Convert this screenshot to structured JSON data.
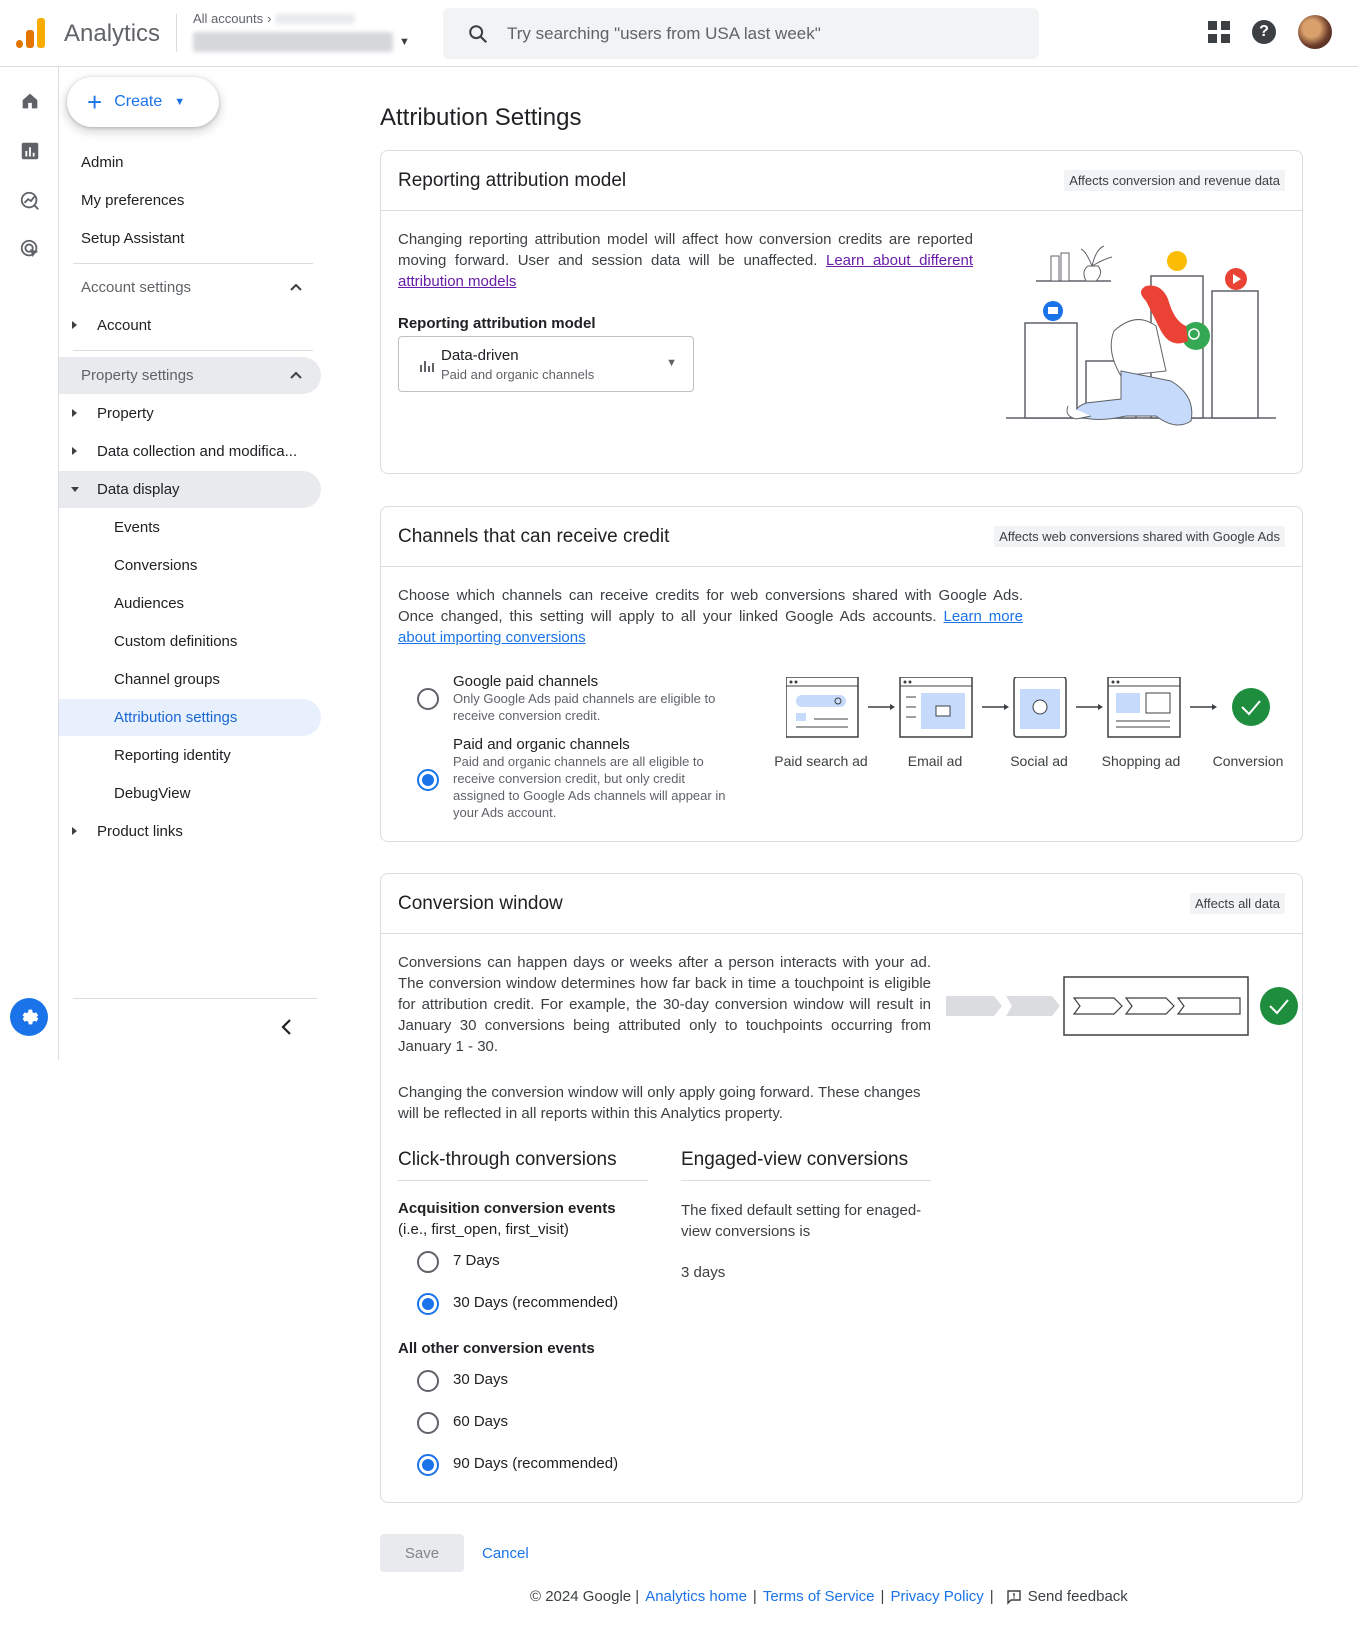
{
  "app": {
    "title": "Analytics",
    "breadcrumb": "All accounts",
    "search_placeholder": "Try searching \"users from USA last week\""
  },
  "nav": {
    "create_label": "Create",
    "admin": "Admin",
    "my_preferences": "My preferences",
    "setup_assistant": "Setup Assistant",
    "account_settings": "Account settings",
    "account": "Account",
    "property_settings": "Property settings",
    "property": "Property",
    "data_collection": "Data collection and modifica...",
    "data_display": "Data display",
    "events": "Events",
    "conversions": "Conversions",
    "audiences": "Audiences",
    "custom_definitions": "Custom definitions",
    "channel_groups": "Channel groups",
    "attribution_settings": "Attribution settings",
    "reporting_identity": "Reporting identity",
    "debugview": "DebugView",
    "product_links": "Product links"
  },
  "page": {
    "title": "Attribution Settings"
  },
  "reporting_card": {
    "title": "Reporting attribution model",
    "chip": "Affects conversion and revenue data",
    "body": "Changing reporting attribution model will affect how conversion credits are reported moving forward. User and session data will be unaffected. ",
    "link": "Learn about different attribution models",
    "field_label": "Reporting attribution model",
    "selected_model": "Data-driven",
    "selected_model_sub": "Paid and organic channels"
  },
  "channels_card": {
    "title": "Channels that can receive credit",
    "chip": "Affects web conversions shared with Google Ads",
    "body": "Choose which channels can receive credits for web conversions shared with Google Ads. Once changed, this setting will apply to all your linked Google Ads accounts. ",
    "link": "Learn more about importing conversions",
    "option1_title": "Google paid channels",
    "option1_sub": "Only Google Ads paid channels are eligible to receive conversion credit.",
    "option2_title": "Paid and organic channels",
    "option2_sub": "Paid and organic channels are all eligible to receive conversion credit, but only credit assigned to Google Ads channels will appear in your Ads account.",
    "selected_option": 2,
    "flow": [
      "Paid search ad",
      "Email ad",
      "Social ad",
      "Shopping ad",
      "Conversion"
    ]
  },
  "window_card": {
    "title": "Conversion window",
    "chip": "Affects all data",
    "body1": "Conversions can happen days or weeks after a person interacts with your ad. The conversion window determines how far back in time a touchpoint is eligible for attribution credit. For example, the 30-day conversion window will result in January 30 conversions being attributed only to touchpoints occurring from January 1 - 30.",
    "body2": "Changing the conversion window will only apply going forward. These changes will be reflected in all reports within this Analytics property.",
    "click_through_title": "Click-through conversions",
    "engaged_view_title": "Engaged-view conversions",
    "acq_label": "Acquisition conversion events",
    "acq_sub": "(i.e., first_open, first_visit)",
    "acq_options": [
      "7 Days",
      "30 Days (recommended)"
    ],
    "other_label": "All other conversion events",
    "other_options": [
      "30 Days",
      "60 Days",
      "90 Days (recommended)"
    ],
    "engaged_text": "The fixed default setting for enaged-view conversions is",
    "engaged_value": "3 days"
  },
  "actions": {
    "save": "Save",
    "cancel": "Cancel"
  },
  "footer": {
    "copyright": "© 2024 Google |",
    "analytics_home": "Analytics home",
    "terms": "Terms of Service",
    "privacy": "Privacy Policy",
    "feedback": "Send feedback"
  },
  "colors": {
    "accent": "#1a73e8",
    "success": "#1e8e3e"
  }
}
